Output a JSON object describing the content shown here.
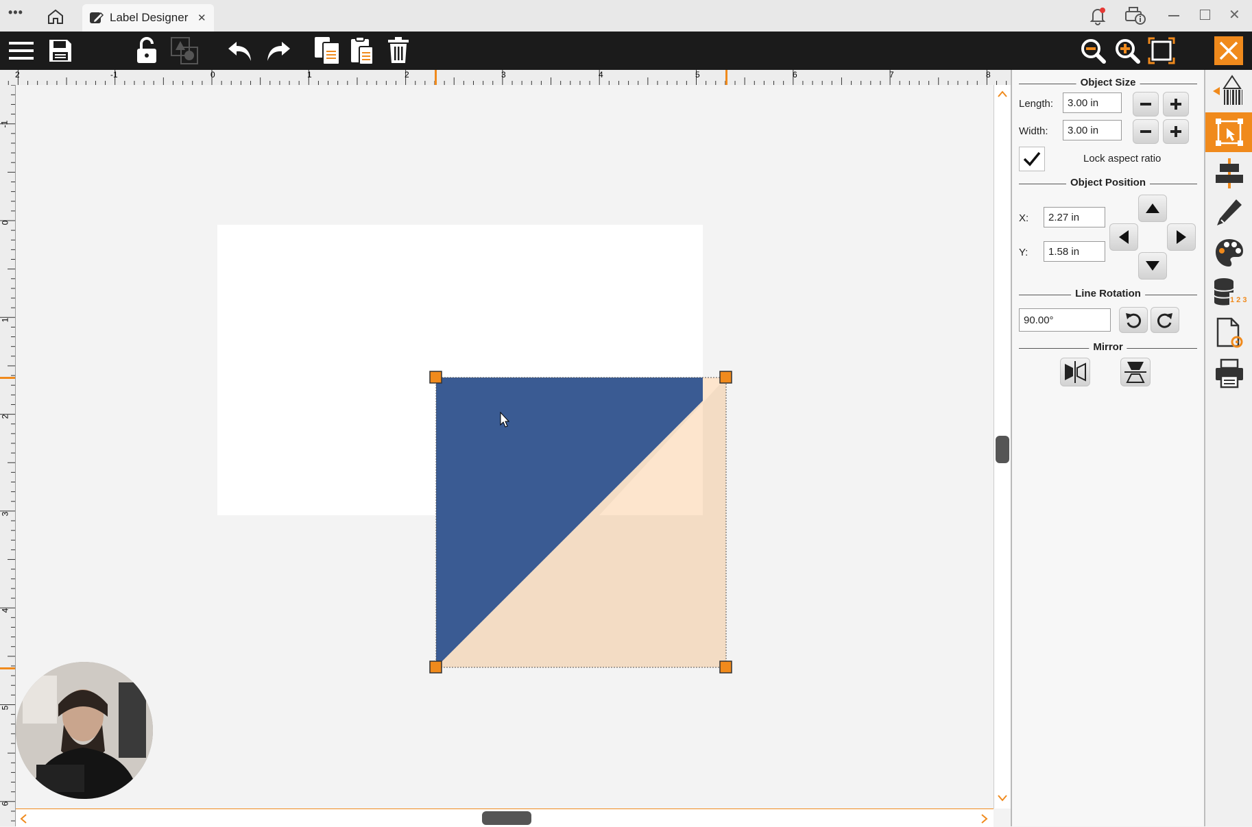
{
  "window": {
    "tab_title": "Label Designer",
    "tab_close": "✕",
    "menu_dots": "•••"
  },
  "ruler": {
    "h_labels": [
      "2",
      "-1",
      "0",
      "1",
      "2",
      "3",
      "4",
      "5",
      "6",
      "7",
      "8"
    ],
    "v_labels": [
      "-1",
      "0",
      "1",
      "2",
      "3",
      "4",
      "5",
      "6"
    ]
  },
  "panel": {
    "object_size": {
      "title": "Object Size",
      "length_label": "Length:",
      "length_value": "3.00 in",
      "width_label": "Width:",
      "width_value": "3.00 in",
      "lock_label": "Lock aspect ratio",
      "lock_checked": true
    },
    "object_position": {
      "title": "Object Position",
      "x_label": "X:",
      "x_value": "2.27 in",
      "y_label": "Y:",
      "y_value": "1.58 in"
    },
    "line_rotation": {
      "title": "Line Rotation",
      "value": "90.00°"
    },
    "mirror": {
      "title": "Mirror"
    }
  },
  "colors": {
    "accent": "#f08a1c",
    "triangle_blue": "#3a5b93",
    "triangle_peach": "#f3dcc4",
    "label_white": "#ffffff",
    "toolbar_bg": "#1b1b1b"
  },
  "icons": {
    "toolbar": [
      "menu-icon",
      "save-icon",
      "unlock-icon",
      "group-icon",
      "undo-icon",
      "redo-icon",
      "copy-icon",
      "paste-icon",
      "delete-icon",
      "zoom-out-icon",
      "zoom-in-icon",
      "fit-icon",
      "close-icon"
    ],
    "sidebar": [
      "barcode-icon",
      "select-shape-icon",
      "align-icon",
      "pencil-icon",
      "palette-icon",
      "database-icon",
      "page-settings-icon",
      "print-icon"
    ]
  }
}
